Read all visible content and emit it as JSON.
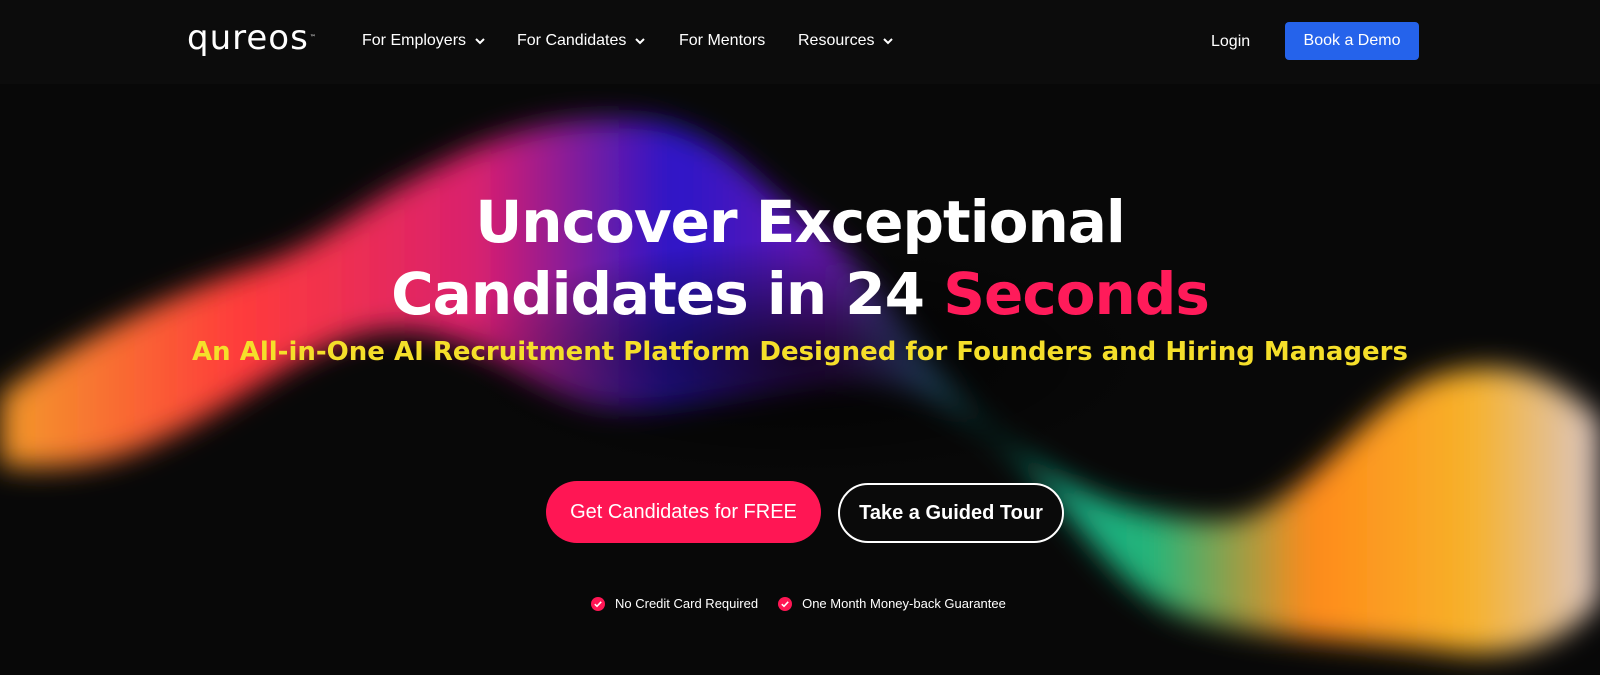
{
  "brand": {
    "logo_text": "qureos",
    "logo_mark": "™"
  },
  "nav": {
    "items": [
      {
        "label": "For Employers",
        "has_dropdown": true
      },
      {
        "label": "For Candidates",
        "has_dropdown": true
      },
      {
        "label": "For Mentors",
        "has_dropdown": false
      },
      {
        "label": "Resources",
        "has_dropdown": true
      }
    ],
    "login_label": "Login",
    "demo_label": "Book a Demo"
  },
  "hero": {
    "title_line1": "Uncover Exceptional",
    "title_line2_prefix": "Candidates in 24 ",
    "title_line2_accent": "Seconds",
    "subtitle": "An All-in-One AI Recruitment Platform Designed for Founders and Hiring Managers",
    "primary_cta": "Get Candidates for FREE",
    "secondary_cta": "Take a Guided Tour",
    "guarantees": [
      {
        "label": "No Credit Card Required",
        "icon": "check-circle-icon"
      },
      {
        "label": "One Month Money-back Guarantee",
        "icon": "check-circle-icon"
      }
    ]
  },
  "colors": {
    "accent_pink": "#ff1654",
    "subtitle_yellow": "#f5df2a",
    "demo_blue": "#2563eb",
    "background": "#080808"
  }
}
